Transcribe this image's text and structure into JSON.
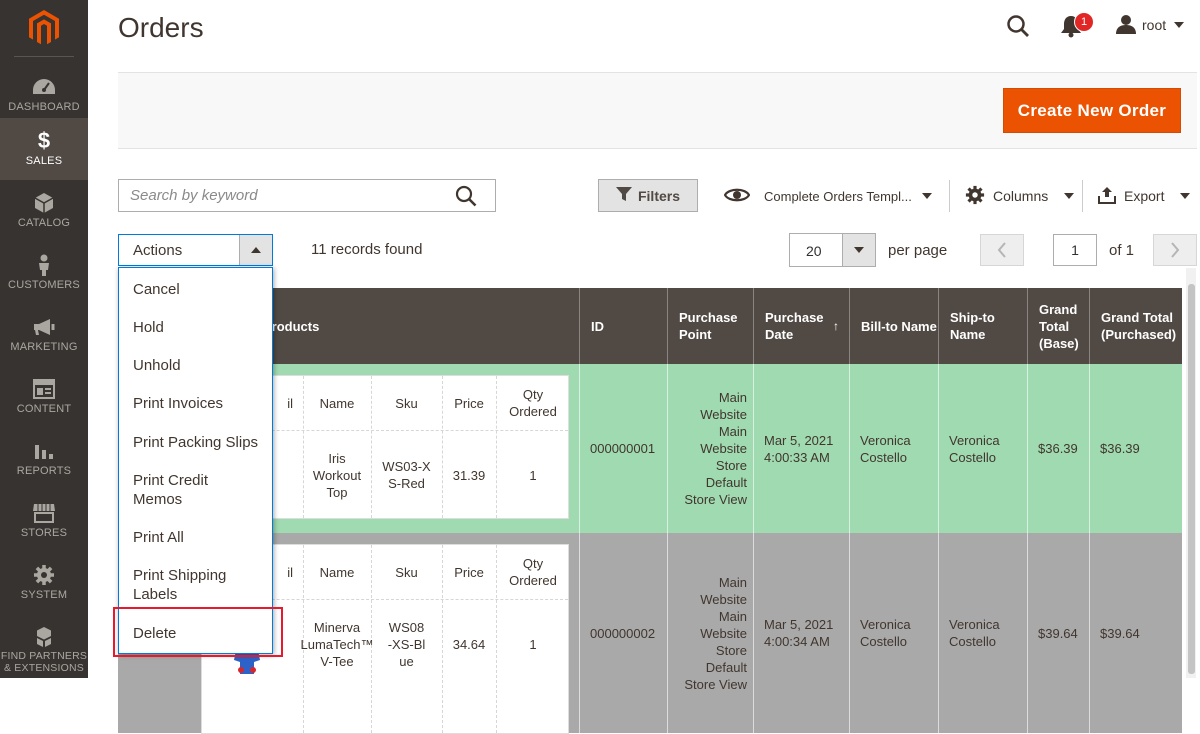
{
  "sidebar": {
    "items": [
      {
        "label": "DASHBOARD",
        "icon": "dashboard-icon"
      },
      {
        "label": "SALES",
        "icon": "dollar-icon"
      },
      {
        "label": "CATALOG",
        "icon": "cube-icon"
      },
      {
        "label": "CUSTOMERS",
        "icon": "person-icon"
      },
      {
        "label": "MARKETING",
        "icon": "megaphone-icon"
      },
      {
        "label": "CONTENT",
        "icon": "layout-icon"
      },
      {
        "label": "REPORTS",
        "icon": "bar-chart-icon"
      },
      {
        "label": "STORES",
        "icon": "storefront-icon"
      },
      {
        "label": "SYSTEM",
        "icon": "gear-icon"
      },
      {
        "label": "FIND PARTNERS & EXTENSIONS",
        "icon": "boxes-icon"
      }
    ],
    "active": "SALES",
    "colors": {
      "bg": "#373330",
      "active_bg": "#514943",
      "logo": "#eb5202"
    }
  },
  "header": {
    "title": "Orders",
    "notification_count": "1",
    "user": "root"
  },
  "page_actions": {
    "create_label": "Create New Order"
  },
  "toolbar": {
    "search_placeholder": "Search by keyword",
    "filters_label": "Filters",
    "view_label": "Complete Orders Templ...",
    "columns_label": "Columns",
    "export_label": "Export"
  },
  "mass_actions": {
    "label": "Actions",
    "items": [
      "Cancel",
      "Hold",
      "Unhold",
      "Print Invoices",
      "Print Packing Slips",
      "Print Credit Memos",
      "Print All",
      "Print Shipping Labels",
      "Delete"
    ],
    "highlighted": "Delete"
  },
  "pager": {
    "records_found": "11 records found",
    "per_page": "20",
    "per_page_label": "per page",
    "page": "1",
    "of_label": "of 1"
  },
  "grid": {
    "headers": {
      "products": "Products",
      "id": "ID",
      "purchase_point": "Purchase Point",
      "purchase_date": "Purchase Date",
      "sort_arrow": "↑",
      "bill_to": "Bill-to Name",
      "ship_to": "Ship-to Name",
      "grand_total_base": "Grand Total (Base)",
      "grand_total_purchased": "Grand Total (Purchased)"
    },
    "sub_headers": {
      "thumbnail": "il",
      "name": "Name",
      "sku": "Sku",
      "price": "Price",
      "qty": "Qty Ordered"
    },
    "rows": [
      {
        "product_name": "Iris Workout Top",
        "sku": "WS03-XS-Red",
        "price": "31.39",
        "qty": "1",
        "id": "000000001",
        "purchase_point": "Main Website Main Website Store Default Store View",
        "purchase_date": "Mar 5, 2021 4:00:33 AM",
        "bill_to": "Veronica Costello",
        "ship_to": "Veronica Costello",
        "grand_total_base": "$36.39",
        "grand_total_purchased": "$36.39"
      },
      {
        "product_name": "Minerva LumaTech™ V-Tee",
        "sku": "WS08-XS-Blue",
        "price": "34.64",
        "qty": "1",
        "id": "000000002",
        "purchase_point": "Main Website Main Website Store Default Store View",
        "purchase_date": "Mar 5, 2021 4:00:34 AM",
        "bill_to": "Veronica Costello",
        "ship_to": "Veronica Costello",
        "grand_total_base": "$39.64",
        "grand_total_purchased": "$39.64"
      }
    ]
  }
}
